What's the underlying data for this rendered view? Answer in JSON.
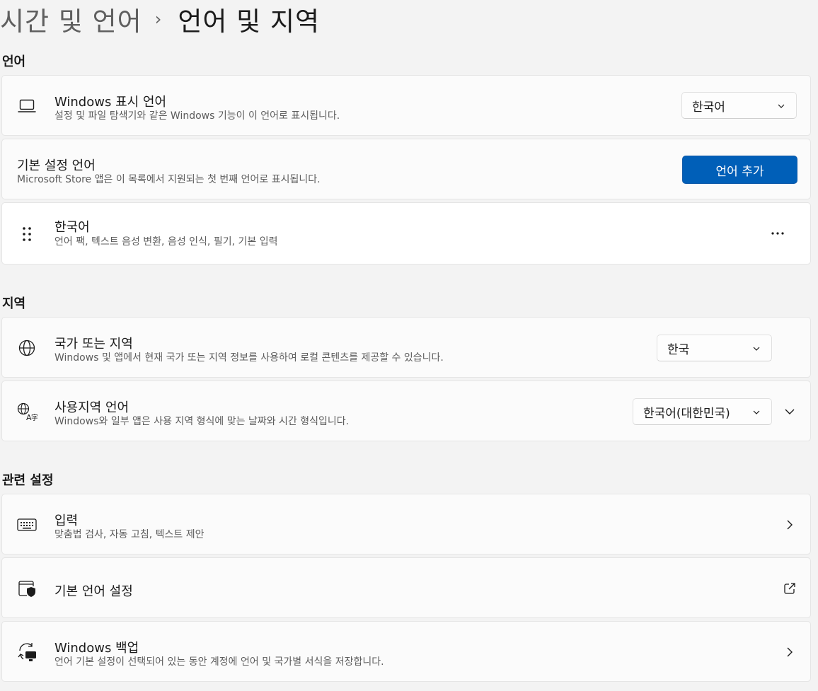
{
  "breadcrumb": {
    "parent": "시간 및 언어",
    "separator": "›",
    "current": "언어 및 지역"
  },
  "sections": {
    "language": "언어",
    "region": "지역",
    "related": "관련 설정"
  },
  "display_language": {
    "icon": "laptop-icon",
    "title": "Windows 표시 언어",
    "description": "설정 및 파일 탐색기와 같은 Windows 기능이 이 언어로 표시됩니다.",
    "selected": "한국어"
  },
  "preferred_languages": {
    "title": "기본 설정 언어",
    "description": "Microsoft Store 앱은 이 목록에서 지원되는 첫 번째 언어로 표시됩니다.",
    "add_button": "언어 추가"
  },
  "language_item": {
    "icon": "drag-handle-icon",
    "title": "한국어",
    "description": "언어 팩, 텍스트 음성 변환, 음성 인식, 필기, 기본 입력",
    "more_icon": "more-options-icon"
  },
  "country_region": {
    "icon": "globe-icon",
    "title": "국가 또는 지역",
    "description": "Windows 및 앱에서 현재 국가 또는 지역 정보를 사용하여 로컬 콘텐츠를 제공할 수 있습니다.",
    "selected": "한국"
  },
  "regional_format": {
    "icon": "language-region-icon",
    "title": "사용지역 언어",
    "description": "Windows와 일부 앱은 사용 지역 형식에 맞는 날짜와 시간 형식입니다.",
    "selected": "한국어(대한민국)"
  },
  "typing": {
    "icon": "keyboard-icon",
    "title": "입력",
    "description": "맞춤법 검사, 자동 고침, 텍스트 제안"
  },
  "admin_language": {
    "icon": "admin-shield-icon",
    "title": "기본 언어 설정"
  },
  "backup": {
    "icon": "sync-backup-icon",
    "title": "Windows 백업",
    "description": "언어 기본 설정이 선택되어 있는 동안 계정에 언어 및 국가별 서식을 저장합니다."
  },
  "colors": {
    "accent": "#005fb8",
    "background": "#f3f3f3",
    "card": "#fbfbfb"
  }
}
